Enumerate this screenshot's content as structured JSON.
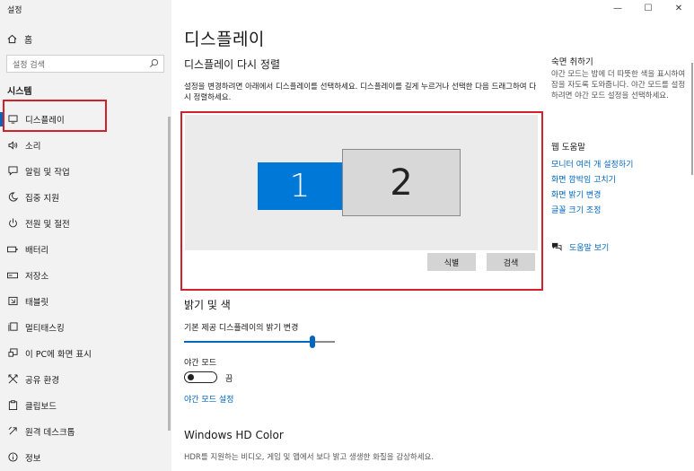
{
  "window": {
    "title": "설정",
    "controls": {
      "minimize": "—",
      "maximize": "☐",
      "close": "✕"
    }
  },
  "sidebar": {
    "home_label": "홈",
    "search_placeholder": "설정 검색",
    "section_label": "시스템",
    "items": [
      {
        "label": "디스플레이",
        "icon": "monitor-icon",
        "selected": true
      },
      {
        "label": "소리",
        "icon": "speaker-icon"
      },
      {
        "label": "알림 및 작업",
        "icon": "notification-icon"
      },
      {
        "label": "집중 지원",
        "icon": "moon-icon"
      },
      {
        "label": "전원 및 절전",
        "icon": "power-icon"
      },
      {
        "label": "배터리",
        "icon": "battery-icon"
      },
      {
        "label": "저장소",
        "icon": "storage-icon"
      },
      {
        "label": "태블릿",
        "icon": "tablet-icon"
      },
      {
        "label": "멀티태스킹",
        "icon": "multitasking-icon"
      },
      {
        "label": "이 PC에 화면 표시",
        "icon": "project-icon"
      },
      {
        "label": "공유 환경",
        "icon": "shared-icon"
      },
      {
        "label": "클립보드",
        "icon": "clipboard-icon"
      },
      {
        "label": "원격 데스크톱",
        "icon": "remote-desktop-icon"
      },
      {
        "label": "정보",
        "icon": "info-icon"
      }
    ]
  },
  "main": {
    "title": "디스플레이",
    "arrange_title": "디스플레이 다시 정렬",
    "arrange_desc": "설정을 변경하려면 아래에서 디스플레이를 선택하세요. 디스플레이를 길게 누르거나 선택한 다음 드래그하여 다시 정렬하세요.",
    "monitors": [
      "1",
      "2"
    ],
    "identify_button": "식별",
    "detect_button": "검색",
    "brightness_section": "밝기 및 색",
    "brightness_label": "기본 제공 디스플레이의 밝기 변경",
    "brightness_value": 0.85,
    "night_mode_label": "야간 모드",
    "night_mode_state": "끔",
    "night_mode_link": "야간 모드 설정",
    "hdr_title": "Windows HD Color",
    "hdr_desc": "HDR를 지원하는 비디오, 게임 및 앱에서 보다 밝고 생생한 화질을 감상하세요."
  },
  "right_panel": {
    "title1": "숙면 취하기",
    "desc1": "야간 모드는 밤에 더 따뜻한 색을 표시하여 잠을 자도록 도와줍니다. 야간 모드를 설정하려면 야간 모드 설정을 선택하세요.",
    "title2": "웹 도움말",
    "links": [
      "모니터 여러 개 설정하기",
      "화면 깜박임 고치기",
      "화면 밝기 변경",
      "글꼴 크기 조정"
    ],
    "help_link": "도움말 보기"
  },
  "colors": {
    "accent": "#0067c0",
    "monitor_selected": "#0078d7",
    "highlight_box": "#d0212c"
  }
}
